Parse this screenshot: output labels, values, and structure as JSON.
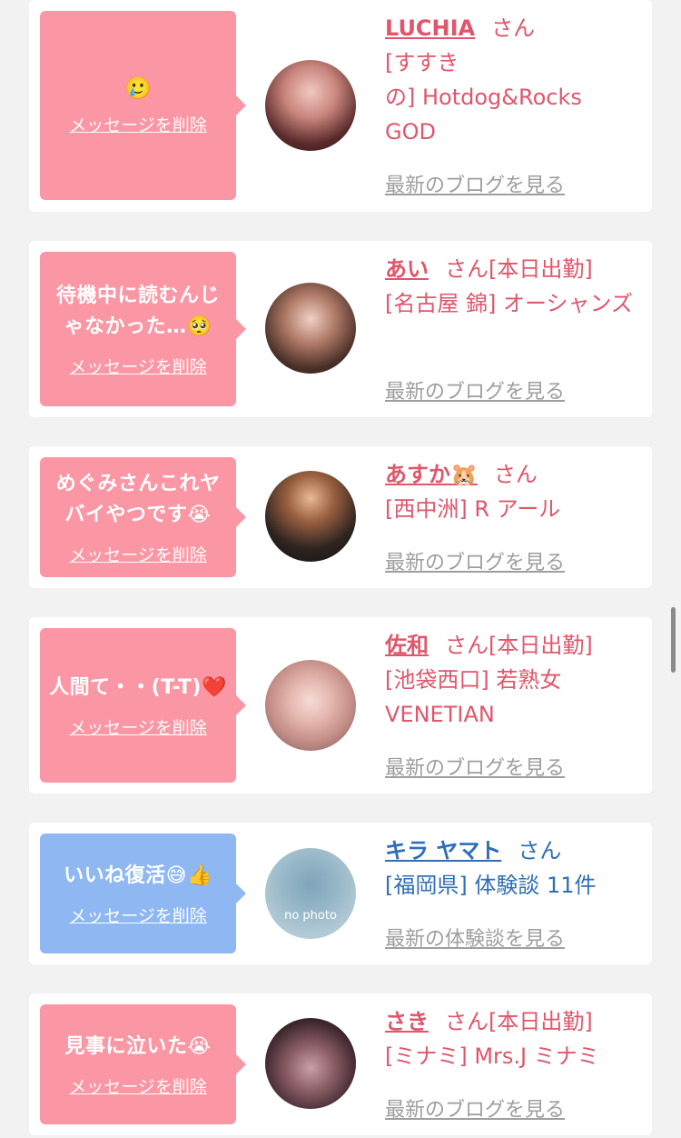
{
  "cards": [
    {
      "message": "",
      "emoji": "🥲",
      "delete_label": "メッセージを削除",
      "name": "LUCHIA",
      "suffix": "さん",
      "detail": "[すすき\nの] Hotdog&Rocks\nGOD",
      "blog_link": "最新のブログを見る",
      "color": "#fb97a4"
    },
    {
      "message": "待機中に読むんじゃなかった…🥺",
      "delete_label": "メッセージを削除",
      "name": "あい",
      "suffix": "さん[本日出勤]",
      "detail": "[名古屋 錦] オーシャンズ",
      "blog_link": "最新のブログを見る",
      "color": "#fb97a4"
    },
    {
      "message": "めぐみさんこれヤバイやつです😭",
      "delete_label": "メッセージを削除",
      "name": "あすか🐹",
      "suffix": "さん",
      "detail": "[西中洲] R アール",
      "blog_link": "最新のブログを見る",
      "color": "#fb97a4"
    },
    {
      "message": "人間て・・(T-T)❤️",
      "delete_label": "メッセージを削除",
      "name": "佐和",
      "suffix": "さん[本日出勤]",
      "detail": "[池袋西口] 若熟女VENETIAN",
      "blog_link": "最新のブログを見る",
      "color": "#fb97a4"
    },
    {
      "message": "いいね復活😅👍",
      "delete_label": "メッセージを削除",
      "name": "キラ ヤマト",
      "suffix": "さん",
      "detail": "[福岡県] 体験談 11件",
      "blog_link": "最新の体験談を見る",
      "avatar_text": "no photo",
      "color": "#8fb8f3"
    },
    {
      "message": "見事に泣いた😭",
      "delete_label": "メッセージを削除",
      "name": "さき",
      "suffix": "さん[本日出勤]",
      "detail": "[ミナミ] Mrs.J ミナミ",
      "blog_link": "最新のブログを見る",
      "color": "#fb97a4"
    }
  ]
}
